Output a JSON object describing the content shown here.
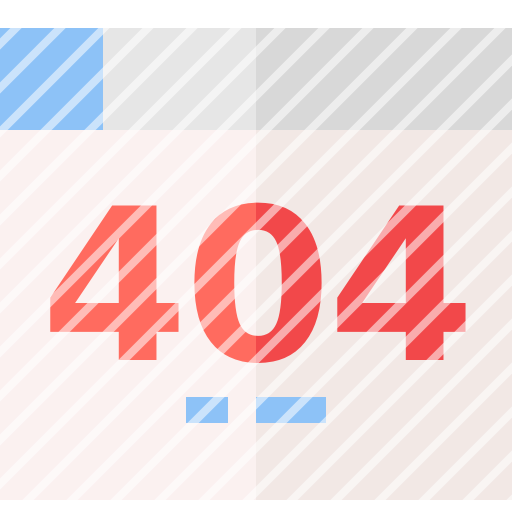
{
  "error": {
    "code": "404"
  },
  "icon": {
    "name": "page-not-found-icon"
  },
  "colors": {
    "accent": "#8dc2f7",
    "bar_left": "#e6e6e6",
    "bar_right": "#d8d8d8",
    "body_left": "#fbf1f0",
    "body_right": "#f2e8e5",
    "code_left": "#ff6b5f",
    "code_right": "#f2484a",
    "stripe": "rgba(255,255,255,0.55)"
  }
}
